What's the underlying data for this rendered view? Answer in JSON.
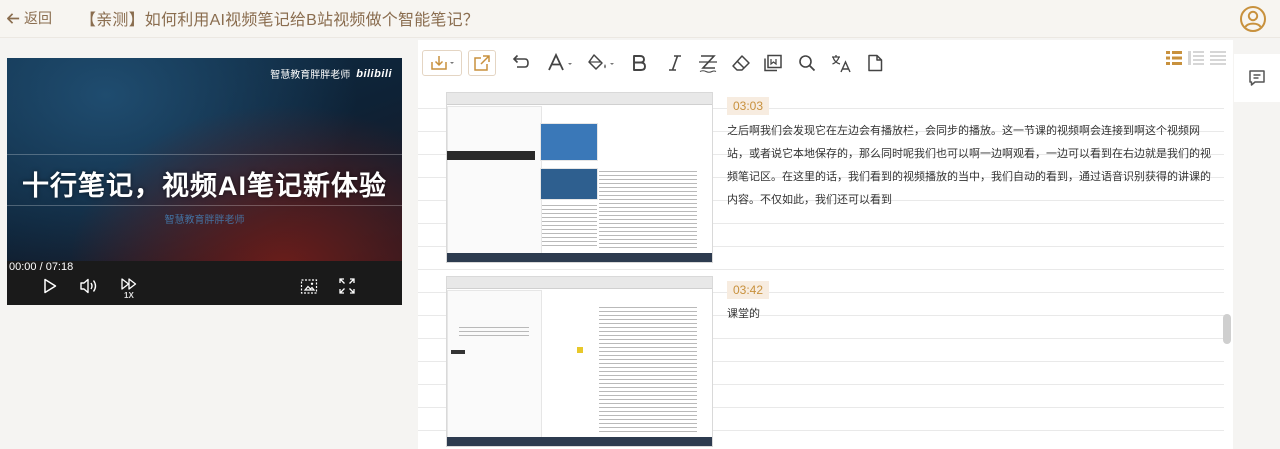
{
  "header": {
    "back_label": "返回",
    "title": "【亲测】如何利用AI视频笔记给B站视频做个智能笔记？",
    "avatar_icon": "user-avatar-icon"
  },
  "video": {
    "channel": "智慧教育胖胖老师",
    "brand": "bilibili",
    "headline": "十行笔记，视频AI笔记新体验",
    "subtitle": "智慧教育胖胖老师",
    "time": "00:00 / 07:18",
    "speed": "1X",
    "controls": [
      "play-icon",
      "volume-icon",
      "speed-icon",
      "screenshot-icon",
      "fullscreen-icon"
    ]
  },
  "toolbar": {
    "tools": [
      "download-icon",
      "share-icon",
      "undo-icon",
      "font-size-icon",
      "fill-color-icon",
      "bold-icon",
      "italic-icon",
      "strikethrough-icon",
      "eraser-icon",
      "copy-icon",
      "search-icon",
      "translate-icon",
      "document-icon"
    ],
    "views": [
      "view-list-icon",
      "view-compact-icon",
      "view-lines-icon"
    ],
    "accent": "#c8913d"
  },
  "notes": [
    {
      "timestamp": "03:03",
      "text": "之后啊我们会发现它在左边会有播放栏，会同步的播放。这一节课的视频啊会连接到啊这个视频网站，或者说它本地保存的，那么同时呢我们也可以啊一边啊观看，一边可以看到在右边就是我们的视频笔记区。在这里的话，我们看到的视频播放的当中，我们自动的看到，通过语音识别获得的讲课的内容。不仅如此，我们还可以看到"
    },
    {
      "timestamp": "03:42",
      "text": "课堂的"
    }
  ],
  "side": {
    "comment_icon": "comment-icon"
  }
}
